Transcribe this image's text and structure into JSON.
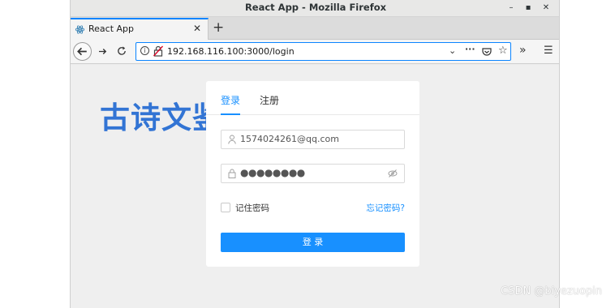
{
  "window": {
    "title": "React App - Mozilla Firefox"
  },
  "browser": {
    "tab_label": "React App",
    "url": "192.168.116.100:3000/login"
  },
  "page": {
    "site_title": "古诗文鉴",
    "tabs": {
      "login": "登录",
      "register": "注册"
    },
    "username_value": "1574024261@qq.com",
    "password_mask": "●●●●●●●●",
    "remember_label": "记住密码",
    "forgot_label": "忘记密码?",
    "submit_label": "登 录"
  },
  "watermark": "CSDN @biyezuopin",
  "colors": {
    "accent": "#1890ff",
    "title": "#3274d4"
  }
}
